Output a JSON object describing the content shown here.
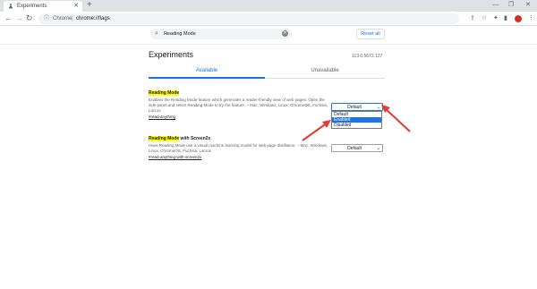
{
  "tab": {
    "title": "Experiments",
    "close": "✕",
    "new": "+"
  },
  "window": {
    "minimize": "—",
    "maximize": "❐",
    "close": "✕"
  },
  "toolbar": {
    "back": "←",
    "forward": "→",
    "reload": "↻",
    "site_icon": "ⓘ",
    "chrome_label": "Chrome",
    "separator": "|",
    "url": "chrome://flags",
    "icons": [
      "share-icon",
      "star-icon",
      "puzzle-icon",
      "sidepanel-icon",
      "extension-icon",
      "menu-icon"
    ]
  },
  "search": {
    "value": "Reading Mode",
    "clear": "✕",
    "glyph": "⌕"
  },
  "reset_label": "Reset all",
  "page_title": "Experiments",
  "version": "113.0.5672.127",
  "tabs": {
    "available": "Available",
    "unavailable": "Unavailable"
  },
  "flags": [
    {
      "name_highlight": "Reading Mode",
      "name_rest": "",
      "description": "Enables the Reading Mode feature which generates a reader-friendly view of web pages. Open the side panel and select Reading Mode to try the feature. – Mac, Windows, Linux, ChromeOS, Fuchsia, Lacros",
      "link": "#read-anything",
      "select_value": "Default"
    },
    {
      "name_highlight": "Reading Mode",
      "name_rest": " with Screen2x",
      "description": "Have Reading Mode use a visual machine learning model for web page distillation. – Mac, Windows, Linux, ChromeOS, Fuchsia, Lacros",
      "link": "#read-anything-with-screen2x",
      "select_value": "Default"
    }
  ],
  "dropdown_options": [
    "Default",
    "Enabled",
    "Disabled"
  ],
  "selected_option": "Enabled",
  "colors": {
    "accent": "#1a73e8",
    "highlight": "#ffff00",
    "annotation": "#e53935"
  }
}
